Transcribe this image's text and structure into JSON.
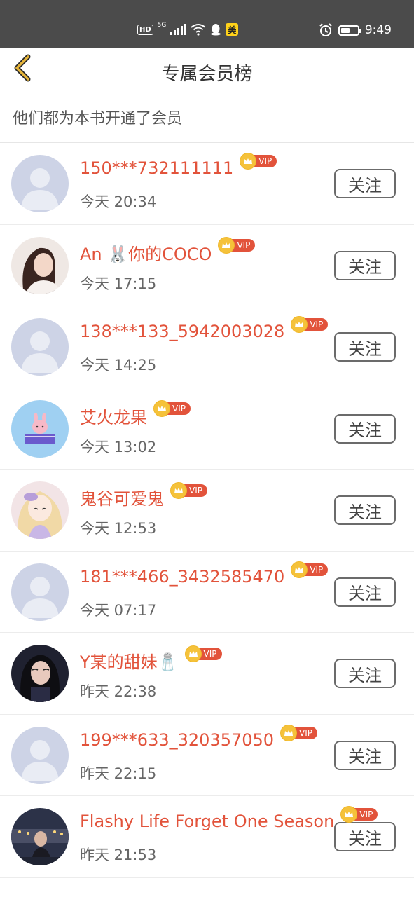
{
  "status_bar": {
    "hd": "HD",
    "network": "5G",
    "app_badge": "美",
    "time": "9:49"
  },
  "header": {
    "title": "专属会员榜",
    "back_icon": "chevron-left-icon"
  },
  "subtitle": "他们都为本书开通了会员",
  "vip_label": "VIP",
  "follow_label": "关注",
  "members": [
    {
      "name": "150***732111111",
      "time": "今天 20:34",
      "avatar": "default"
    },
    {
      "name": "An 🐰你的COCO",
      "time": "今天 17:15",
      "avatar": "photo-woman"
    },
    {
      "name": "138***133_5942003028",
      "time": "今天 14:25",
      "avatar": "default"
    },
    {
      "name": "艾火龙果",
      "time": "今天 13:02",
      "avatar": "cartoon-bunny"
    },
    {
      "name": "鬼谷可爱鬼",
      "time": "今天 12:53",
      "avatar": "anime-girl"
    },
    {
      "name": "181***466_3432585470",
      "time": "今天 07:17",
      "avatar": "default"
    },
    {
      "name": "Y某的甜妹🧂",
      "time": "昨天 22:38",
      "avatar": "photo-dark"
    },
    {
      "name": "199***633_320357050",
      "time": "昨天 22:15",
      "avatar": "default"
    },
    {
      "name": "Flashy Life Forget One Season",
      "time": "昨天 21:53",
      "avatar": "photo-night"
    }
  ],
  "colors": {
    "accent": "#e2533b",
    "status_bar_bg": "#4b4b4b",
    "back_icon": "#e6b53a",
    "crown": "#f5c23a"
  }
}
